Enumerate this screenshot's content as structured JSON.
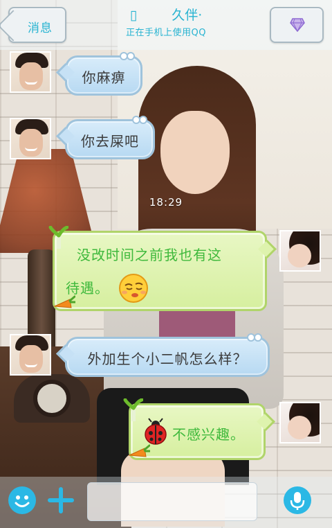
{
  "header": {
    "back_label": "消息",
    "title_glyph": "▯",
    "title": "久伴·",
    "subtitle": "正在手机上使用QQ"
  },
  "messages": [
    {
      "side": "left",
      "style": "blue",
      "text": "你麻痹"
    },
    {
      "side": "left",
      "style": "blue",
      "text": "你去屎吧"
    },
    {
      "side": "right",
      "style": "green",
      "text_line1": "没改时间之前我也有这",
      "text_line2": "待遇。"
    },
    {
      "side": "left",
      "style": "blue",
      "text": "外加生个小二帆怎么样？"
    },
    {
      "side": "right",
      "style": "green",
      "text": "不感兴趣。"
    }
  ],
  "timestamp": "18:29",
  "input": {
    "value": "",
    "placeholder": ""
  },
  "icons": {
    "back": "back-arrow-icon",
    "gem": "diamond-icon",
    "emoji": "smiley-icon",
    "plus": "plus-icon",
    "mic": "microphone-icon"
  },
  "colors": {
    "accent": "#27b3d1",
    "toolbar_button": "#2bb8e5",
    "green_text": "#3fb93c",
    "blue_bubble": "#c6e1f5",
    "green_bubble": "#def3ae"
  }
}
